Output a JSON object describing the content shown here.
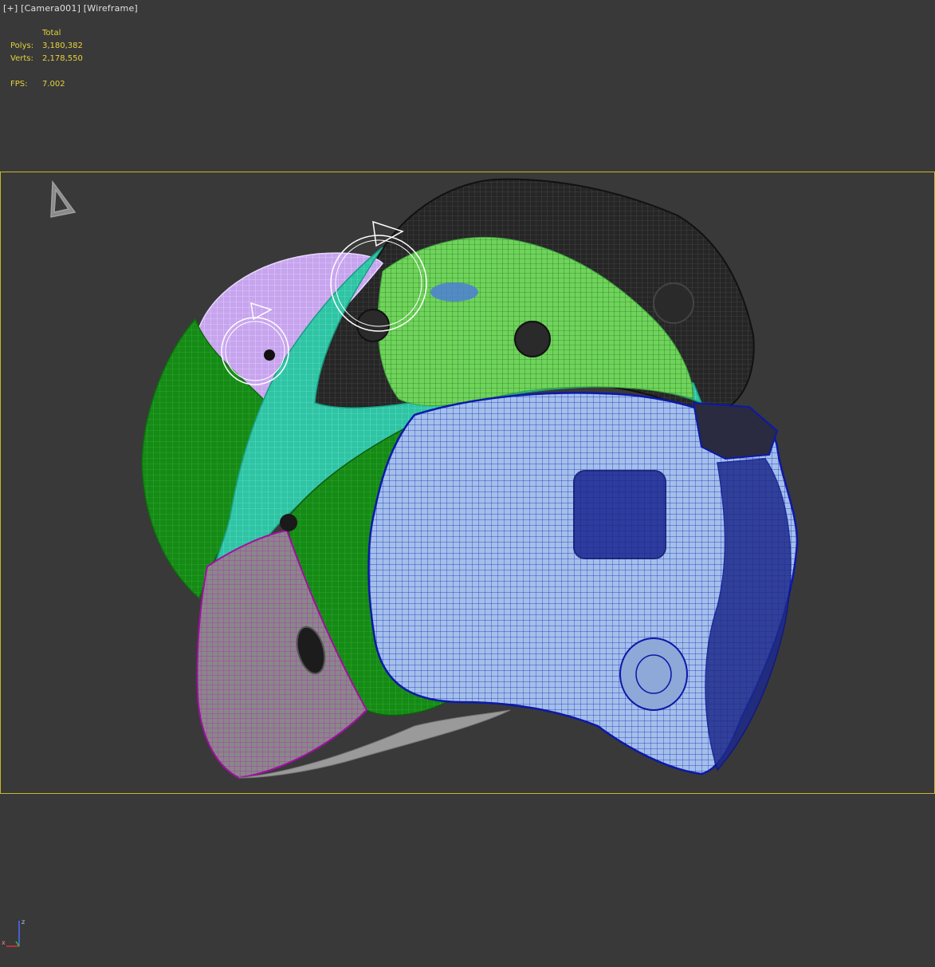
{
  "viewport": {
    "label_parts": [
      "[+]",
      "[Camera001]",
      "[Wireframe]"
    ]
  },
  "stats": {
    "header": "Total",
    "polys_label": "Polys:",
    "polys_value": "3,180,382",
    "verts_label": "Verts:",
    "verts_value": "2,178,550",
    "fps_label": "FPS:",
    "fps_value": "7.002"
  },
  "colors": {
    "background": "#393939",
    "stats_text": "#e6d23c",
    "safe_frame": "#c9b72a",
    "mesh_black": "#1c1c1c",
    "mesh_green": "#1f9a1f",
    "mesh_teal": "#2fc9a9",
    "mesh_lavender": "#c9a6f0",
    "mesh_blue": "#9ab8e6",
    "mesh_magenta": "#b01bb0",
    "mesh_lightgreen": "#7ddc6a"
  },
  "icons": [
    "camera-target-icon",
    "orbit-gizmo-icon",
    "axis-tripod-icon"
  ],
  "axis": {
    "z": "z",
    "x": "x"
  }
}
